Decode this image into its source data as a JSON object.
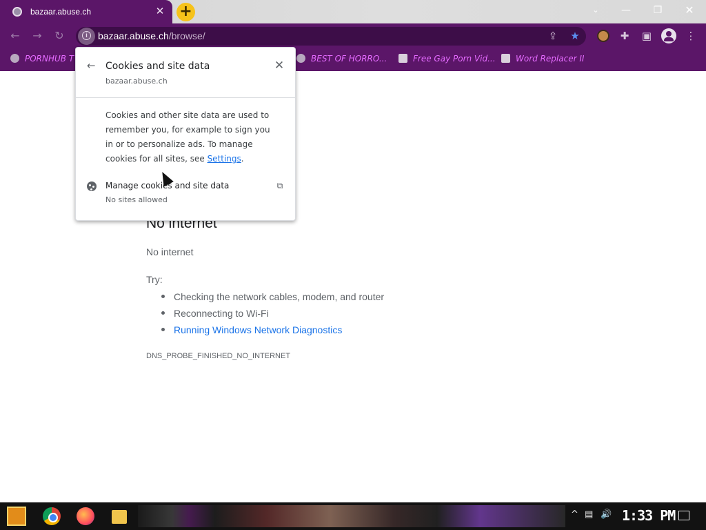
{
  "tab": {
    "title": "bazaar.abuse.ch",
    "close": "✕"
  },
  "toolbar": {
    "new_tab": "+",
    "back": "←",
    "forward": "→",
    "reload": "↻",
    "url_host": "bazaar.abuse.ch",
    "url_path": "/browse/"
  },
  "window_controls": {
    "chevron": "⌄",
    "minimize": "—",
    "maximize": "❐",
    "close": "✕"
  },
  "bookmarks": [
    {
      "label": "PORNHUB T"
    },
    {
      "label": "BEST OF HORRO..."
    },
    {
      "label": "Free Gay Porn Vid..."
    },
    {
      "label": "Word Replacer II"
    }
  ],
  "popup": {
    "back": "←",
    "title": "Cookies and site data",
    "host": "bazaar.abuse.ch",
    "close": "✕",
    "desc_text": "Cookies and other site data are used to remember you, for example to sign you in or to personalize ads. To manage cookies for all sites, see ",
    "desc_link": "Settings",
    "desc_end": ".",
    "manage_label": "Manage cookies and site data",
    "manage_sub": "No sites allowed",
    "external": "⧉"
  },
  "error_page": {
    "title": "No internet",
    "subtitle": "No internet",
    "try_label": "Try:",
    "suggestions": [
      "Checking the network cables, modem, and router",
      "Reconnecting to Wi-Fi",
      "Running Windows Network Diagnostics"
    ],
    "error_code": "DNS_PROBE_FINISHED_NO_INTERNET"
  },
  "taskbar": {
    "clock": "1:33 PM"
  },
  "colors": {
    "accent": "#5b1668",
    "link": "#1a73e8",
    "bookmark_text": "#e56bff"
  }
}
